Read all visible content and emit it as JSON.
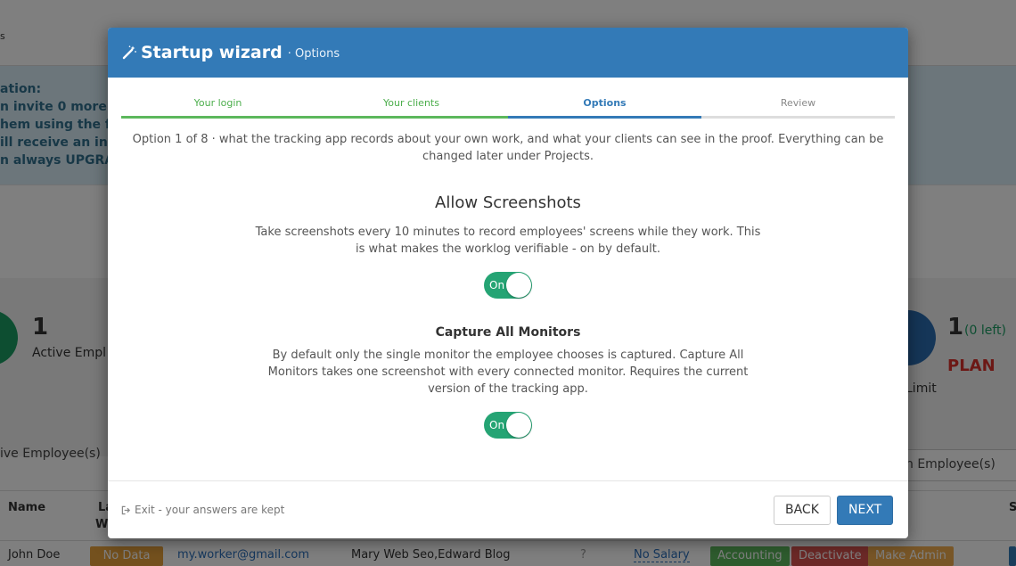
{
  "background": {
    "topbar_text": "s",
    "info_lines": [
      "ation:",
      "n invite 0 more Em",
      "hem using the fo",
      "ill receive an invit",
      "n always UPGRAD"
    ],
    "stats": {
      "active_count": "1",
      "active_label": "Active Empl",
      "limit_count": "1",
      "limit_left": "(0 left)",
      "plan": "PLAN",
      "limit_label": "Limit"
    },
    "tab_active": "ive Employee(s)",
    "tab_other": "n Employee(s)",
    "table_headers": {
      "name": "Name",
      "la": "La",
      "w": "W",
      "s": "S"
    },
    "row": {
      "name": "John Doe",
      "no_data": "No Data",
      "email": "my.worker@gmail.com",
      "clients": "Mary Web Seo,Edward Blog",
      "salary": "No Salary",
      "accounting": "Accounting",
      "deactivate": "Deactivate",
      "make_admin": "Make Admin"
    }
  },
  "modal": {
    "title": "Startup wizard",
    "subtitle": "· Options",
    "steps": [
      {
        "label": "Your login",
        "state": "done"
      },
      {
        "label": "Your clients",
        "state": "done"
      },
      {
        "label": "Options",
        "state": "active"
      },
      {
        "label": "Review",
        "state": "todo"
      }
    ],
    "intro": "Option 1 of 8 · what the tracking app records about your own work, and what your clients can see in the proof. Everything can be changed later under Projects.",
    "options": [
      {
        "title": "Allow Screenshots",
        "description": "Take screenshots every 10 minutes to record employees' screens while they work. This is what makes the worklog verifiable - on by default.",
        "toggle": "On"
      },
      {
        "title": "Capture All Monitors",
        "description": "By default only the single monitor the employee chooses is captured. Capture All Monitors takes one screenshot with every connected monitor. Requires the current version of the tracking app.",
        "toggle": "On"
      }
    ],
    "footer": {
      "exit_label": "Exit - your answers are kept",
      "back_label": "BACK",
      "next_label": "NEXT"
    }
  },
  "colors": {
    "header_blue": "#337ab7",
    "step_done": "#5cb85c",
    "toggle_on": "#25a474",
    "overlay": "rgba(0,0,0,0.5)"
  }
}
